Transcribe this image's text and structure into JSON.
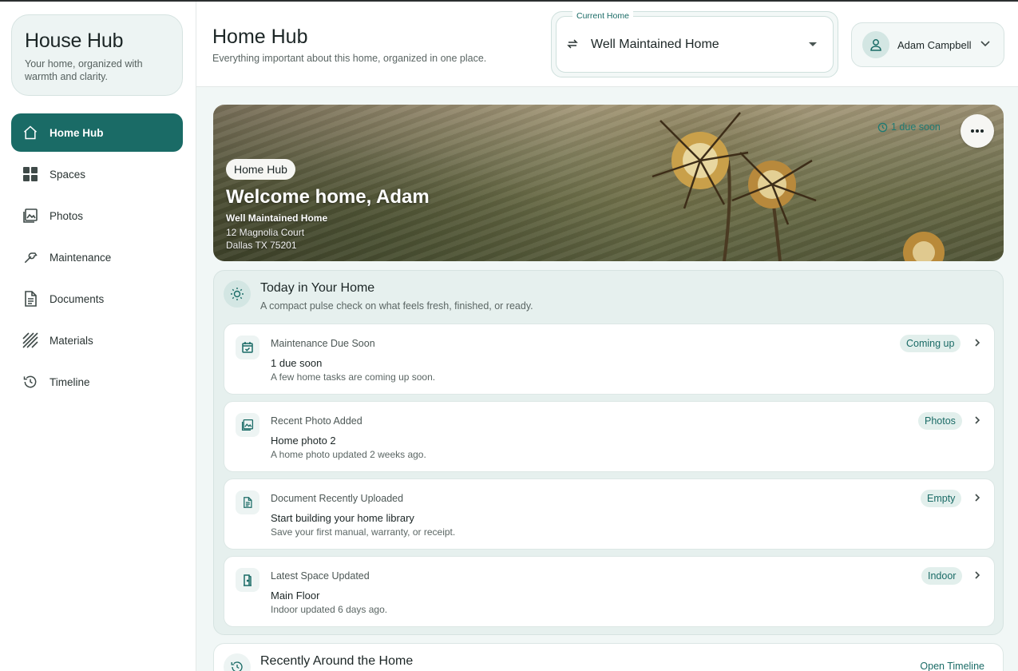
{
  "brand": {
    "title": "House Hub",
    "subtitle": "Your home, organized with warmth and clarity."
  },
  "nav": [
    {
      "label": "Home Hub",
      "icon": "home-icon",
      "active": true
    },
    {
      "label": "Spaces",
      "icon": "grid-icon"
    },
    {
      "label": "Photos",
      "icon": "photo-icon"
    },
    {
      "label": "Maintenance",
      "icon": "wrench-icon"
    },
    {
      "label": "Documents",
      "icon": "document-icon"
    },
    {
      "label": "Materials",
      "icon": "hatch-icon"
    },
    {
      "label": "Timeline",
      "icon": "history-icon"
    }
  ],
  "header": {
    "title": "Home Hub",
    "subtitle": "Everything important about this home, organized in one place.",
    "home_select_label": "Current Home",
    "home_select_value": "Well Maintained Home",
    "user_name": "Adam Campbell"
  },
  "hero": {
    "badge": "Home Hub",
    "title": "Welcome home, Adam",
    "home_name": "Well Maintained Home",
    "address_line1": "12 Magnolia Court",
    "address_line2": "Dallas TX 75201",
    "due_text": "1 due soon"
  },
  "today": {
    "title": "Today in Your Home",
    "subtitle": "A compact pulse check on what feels fresh, finished, or ready.",
    "cards": [
      {
        "kicker": "Maintenance Due Soon",
        "title": "1 due soon",
        "desc": "A few home tasks are coming up soon.",
        "tag": "Coming up",
        "icon": "calendar-check-icon"
      },
      {
        "kicker": "Recent Photo Added",
        "title": "Home photo 2",
        "desc": "A home photo updated 2 weeks ago.",
        "tag": "Photos",
        "icon": "photo-icon"
      },
      {
        "kicker": "Document Recently Uploaded",
        "title": "Start building your home library",
        "desc": "Save your first manual, warranty, or receipt.",
        "tag": "Empty",
        "icon": "document-icon"
      },
      {
        "kicker": "Latest Space Updated",
        "title": "Main Floor",
        "desc": "Indoor updated 6 days ago.",
        "tag": "Indoor",
        "icon": "door-icon"
      }
    ]
  },
  "recent": {
    "title": "Recently Around the Home",
    "link": "Open Timeline"
  },
  "colors": {
    "accent": "#1a6b66",
    "panel": "#e6f0ee",
    "tag_bg": "#e2efec"
  }
}
